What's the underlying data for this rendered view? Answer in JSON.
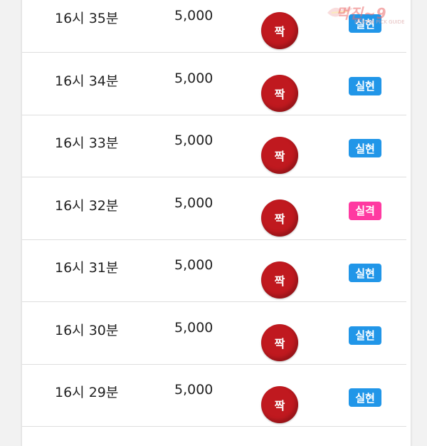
{
  "rows": [
    {
      "time": "16시 35분",
      "amount": "5,000",
      "pick": "짝",
      "result": "실현",
      "result_color": "#2196e8"
    },
    {
      "time": "16시 34분",
      "amount": "5,000",
      "pick": "짝",
      "result": "실현",
      "result_color": "#2196e8"
    },
    {
      "time": "16시 33분",
      "amount": "5,000",
      "pick": "짝",
      "result": "실현",
      "result_color": "#2196e8"
    },
    {
      "time": "16시 32분",
      "amount": "5,000",
      "pick": "짝",
      "result": "실격",
      "result_color": "#ff3aa1"
    },
    {
      "time": "16시 31분",
      "amount": "5,000",
      "pick": "짝",
      "result": "실현",
      "result_color": "#2196e8"
    },
    {
      "time": "16시 30분",
      "amount": "5,000",
      "pick": "짝",
      "result": "실현",
      "result_color": "#2196e8"
    },
    {
      "time": "16시 29분",
      "amount": "5,000",
      "pick": "짝",
      "result": "실현",
      "result_color": "#2196e8"
    }
  ],
  "watermark": {
    "text": "먹진",
    "suffix": "~9",
    "sub": "MUKZIN PICK GUIDE"
  }
}
